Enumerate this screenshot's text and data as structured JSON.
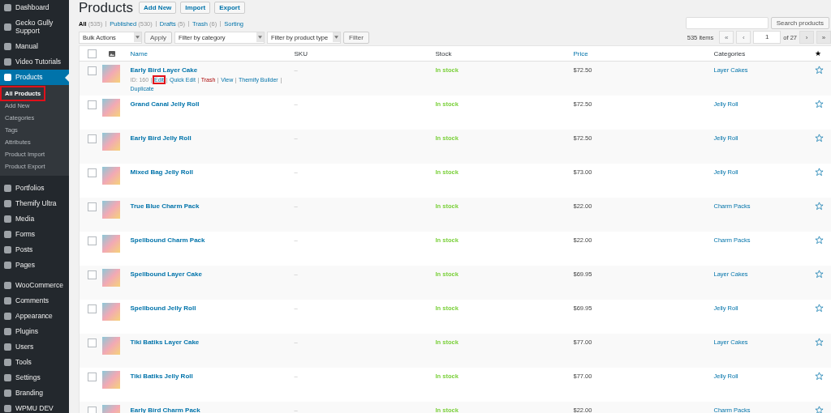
{
  "sidebar": {
    "items": [
      {
        "label": "Dashboard",
        "selected": false
      },
      {
        "label": "Gecko Gully Support",
        "selected": false
      },
      {
        "label": "Manual",
        "selected": false
      },
      {
        "label": "Video Tutorials",
        "selected": false
      },
      {
        "label": "Products",
        "selected": true,
        "children": [
          {
            "label": "All Products",
            "selected": true,
            "highlighted": true
          },
          {
            "label": "Add New",
            "selected": false,
            "highlighted": false
          },
          {
            "label": "Categories",
            "selected": false,
            "highlighted": false
          },
          {
            "label": "Tags",
            "selected": false,
            "highlighted": false
          },
          {
            "label": "Attributes",
            "selected": false,
            "highlighted": false
          },
          {
            "label": "Product Import",
            "selected": false,
            "highlighted": false
          },
          {
            "label": "Product Export",
            "selected": false,
            "highlighted": false
          }
        ]
      },
      {
        "label": "Portfolios",
        "selected": false
      },
      {
        "label": "Themify Ultra",
        "selected": false
      },
      {
        "label": "Media",
        "selected": false
      },
      {
        "label": "Forms",
        "selected": false
      },
      {
        "label": "Posts",
        "selected": false
      },
      {
        "label": "Pages",
        "selected": false
      },
      {
        "label": "WooCommerce",
        "selected": false
      },
      {
        "label": "Comments",
        "selected": false
      },
      {
        "label": "Appearance",
        "selected": false
      },
      {
        "label": "Plugins",
        "selected": false
      },
      {
        "label": "Users",
        "selected": false
      },
      {
        "label": "Tools",
        "selected": false
      },
      {
        "label": "Settings",
        "selected": false
      },
      {
        "label": "Branding",
        "selected": false
      },
      {
        "label": "WPMU DEV",
        "selected": false
      }
    ]
  },
  "page": {
    "title": "Products",
    "buttons": [
      "Add New",
      "Import",
      "Export"
    ]
  },
  "views": [
    {
      "label": "All",
      "count": "(535)",
      "selected": true
    },
    {
      "label": "Published",
      "count": "(530)",
      "selected": false
    },
    {
      "label": "Drafts",
      "count": "(5)",
      "selected": false
    },
    {
      "label": "Trash",
      "count": "(6)",
      "selected": false
    },
    {
      "label": "Sorting",
      "selected": false
    }
  ],
  "search": {
    "button": "Search products"
  },
  "tablenav": {
    "bulk_actions": "Bulk Actions",
    "apply": "Apply",
    "category_filter": "Filter by category",
    "type_filter": "Filter by product type",
    "filter": "Filter",
    "items": "535 items",
    "first": "«",
    "prev": "‹",
    "page": "1",
    "of": "of 27",
    "next": "›",
    "last": "»",
    "first_disabled": true,
    "prev_disabled": true
  },
  "table": {
    "select_all": {
      "checked": false
    },
    "columns": [
      {
        "label": "Name",
        "sortable": true
      },
      {
        "label": "SKU",
        "sortable": false
      },
      {
        "label": "Stock",
        "sortable": false
      },
      {
        "label": "Price",
        "sortable": true
      },
      {
        "label": "Categories",
        "sortable": false
      }
    ],
    "featured_header": "★",
    "rows": [
      {
        "checked": false,
        "name": "Early Bird Layer Cake",
        "id": "ID: 160",
        "actions": [
          {
            "label": "Edit",
            "kind": "link",
            "highlighted": true
          },
          {
            "label": "Quick Edit",
            "kind": "link",
            "highlighted": false
          },
          {
            "label": "Trash",
            "kind": "danger",
            "highlighted": false
          },
          {
            "label": "View",
            "kind": "link",
            "highlighted": false
          },
          {
            "label": "Themify Builder",
            "kind": "link",
            "highlighted": false
          },
          {
            "label": "Duplicate",
            "kind": "link",
            "highlighted": false
          }
        ],
        "sku": "–",
        "stock": "In stock",
        "price": "$72.50",
        "category": "Layer Cakes",
        "featured": false
      },
      {
        "checked": false,
        "name": "Grand Canal Jelly Roll",
        "sku": "–",
        "stock": "In stock",
        "price": "$72.50",
        "category": "Jelly Roll",
        "featured": false
      },
      {
        "checked": false,
        "name": "Early Bird Jelly Roll",
        "sku": "–",
        "stock": "In stock",
        "price": "$72.50",
        "category": "Jelly Roll",
        "featured": false
      },
      {
        "checked": false,
        "name": "Mixed Bag Jelly Roll",
        "sku": "–",
        "stock": "In stock",
        "price": "$73.00",
        "category": "Jelly Roll",
        "featured": false
      },
      {
        "checked": false,
        "name": "True Blue Charm Pack",
        "sku": "–",
        "stock": "In stock",
        "price": "$22.00",
        "category": "Charm Packs",
        "featured": false
      },
      {
        "checked": false,
        "name": "Spellbound Charm Pack",
        "sku": "–",
        "stock": "In stock",
        "price": "$22.00",
        "category": "Charm Packs",
        "featured": false
      },
      {
        "checked": false,
        "name": "Spellbound Layer Cake",
        "sku": "–",
        "stock": "In stock",
        "price": "$69.95",
        "category": "Layer Cakes",
        "featured": false
      },
      {
        "checked": false,
        "name": "Spellbound Jelly Roll",
        "sku": "–",
        "stock": "In stock",
        "price": "$69.95",
        "category": "Jelly Roll",
        "featured": false
      },
      {
        "checked": false,
        "name": "Tiki Batiks Layer Cake",
        "sku": "–",
        "stock": "In stock",
        "price": "$77.00",
        "category": "Layer Cakes",
        "featured": false
      },
      {
        "checked": false,
        "name": "Tiki Batiks Jelly Roll",
        "sku": "–",
        "stock": "In stock",
        "price": "$77.00",
        "category": "Jelly Roll",
        "featured": false
      },
      {
        "checked": false,
        "name": "Early Bird Charm Pack",
        "sku": "–",
        "stock": "In stock",
        "price": "$22.00",
        "category": "Charm Packs",
        "featured": false
      }
    ]
  }
}
